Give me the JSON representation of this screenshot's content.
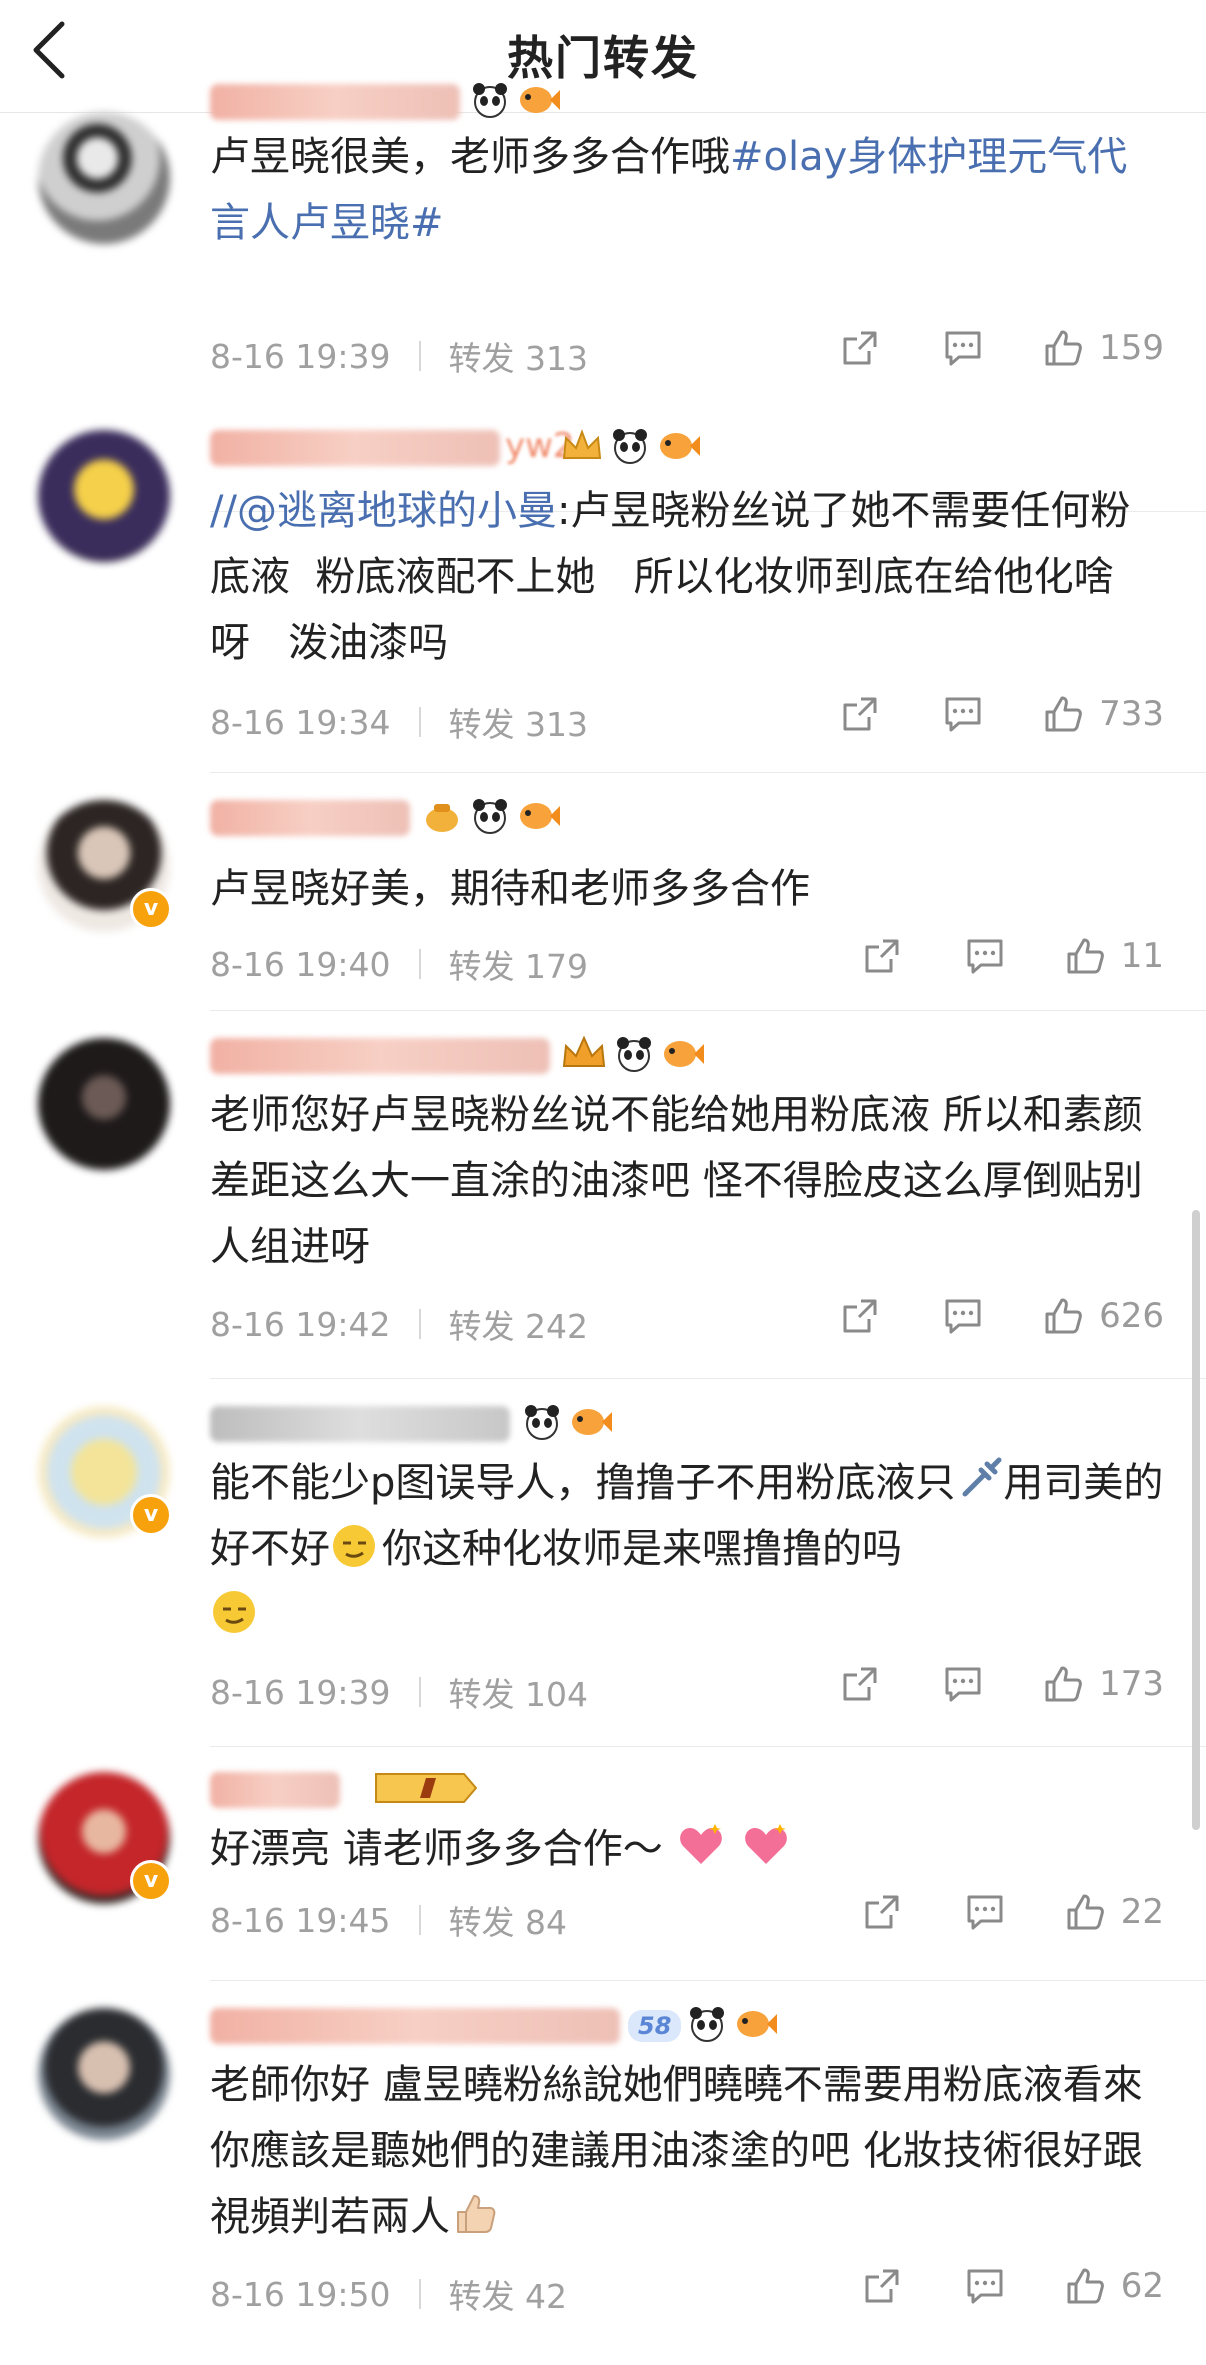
{
  "header": {
    "title": "热门转发"
  },
  "posts": [
    {
      "content_parts": [
        "卢昱晓很美，老师多多合作哦",
        "#olay身体护理元气代言人卢昱晓#"
      ],
      "time": "8-16 19:39",
      "repost_label": "转发 313",
      "likes": "159"
    },
    {
      "mention": "//@逃离地球的小曼",
      "content_text": ":卢昱晓粉丝说了她不需要任何粉底液  粉底液配不上她   所以化妆师到底在给他化啥呀   泼油漆吗",
      "username_partial": "yw2",
      "time": "8-16 19:34",
      "repost_label": "转发 313",
      "likes": "733"
    },
    {
      "content_text": "卢昱晓好美，期待和老师多多合作",
      "time": "8-16 19:40",
      "repost_label": "转发 179",
      "likes": "11"
    },
    {
      "content_text": "老师您好卢昱晓粉丝说不能给她用粉底液 所以和素颜差距这么大一直涂的油漆吧 怪不得脸皮这么厚倒贴别人组进呀",
      "time": "8-16 19:42",
      "repost_label": "转发 242",
      "likes": "626"
    },
    {
      "content_a": "能不能少p图误导人，撸撸子不用粉底液只",
      "content_b": "用司美的好不好",
      "content_c": "你这种化妆师是来嘿撸撸的吗",
      "time": "8-16 19:39",
      "repost_label": "转发 104",
      "likes": "173"
    },
    {
      "content_text": "好漂亮 请老师多多合作～",
      "time": "8-16 19:45",
      "repost_label": "转发 84",
      "likes": "22"
    },
    {
      "content_text": "老師你好 盧昱曉粉絲說她們曉曉不需要用粉底液看來你應該是聽她們的建議用油漆塗的吧 化妝技術很好跟視頻判若兩人",
      "badge_level": "58",
      "time": "8-16 19:50",
      "repost_label": "转发 42",
      "likes": "62"
    }
  ],
  "icons": {
    "back": "chevron-left-icon",
    "repost": "share-icon",
    "comment": "comment-icon",
    "like": "thumbs-up-icon"
  },
  "colors": {
    "link": "#4a6fb0",
    "meta": "#a0a0a0",
    "vip_badge": "#f7a10d"
  }
}
